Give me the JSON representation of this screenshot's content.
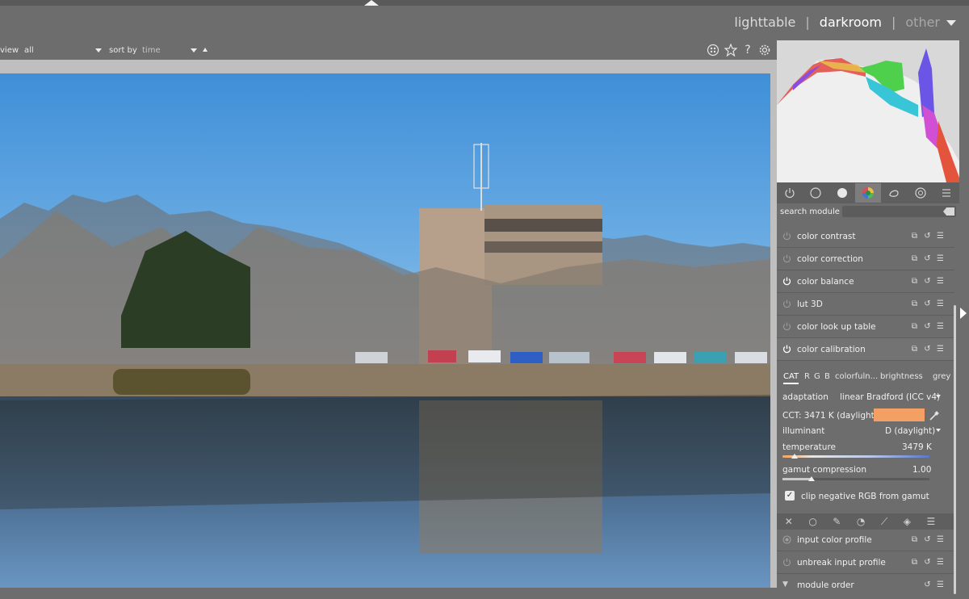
{
  "header": {
    "views": [
      {
        "label": "lighttable",
        "state": "normal"
      },
      {
        "label": "darkroom",
        "state": "active"
      },
      {
        "label": "other",
        "state": "dim"
      }
    ],
    "separator": "|"
  },
  "filterbar": {
    "view_label": "view",
    "view_value": "all",
    "sort_label": "sort by",
    "sort_value": "time"
  },
  "toolbar_icons": [
    "apps-icon",
    "star-icon",
    "help-icon",
    "gear-icon"
  ],
  "search": {
    "label": "search module",
    "placeholder": ""
  },
  "group_tabs": [
    "power-icon",
    "circle-icon",
    "half-circle-icon",
    "color-wheel-icon",
    "correct-icon",
    "effect-icon",
    "menu-icon"
  ],
  "modules_top": [
    {
      "name": "color contrast",
      "enabled": false
    },
    {
      "name": "color correction",
      "enabled": false
    },
    {
      "name": "color balance",
      "enabled": true
    },
    {
      "name": "lut 3D",
      "enabled": false
    },
    {
      "name": "color look up table",
      "enabled": false
    },
    {
      "name": "color calibration",
      "enabled": true,
      "expanded": true
    }
  ],
  "color_calibration": {
    "tabs": [
      "CAT",
      "R",
      "G",
      "B",
      "colorfuln...",
      "brightness",
      "grey"
    ],
    "adaptation_label": "adaptation",
    "adaptation_value": "linear Bradford (ICC v4)",
    "cct_label": "CCT: 3471 K (daylight)",
    "cct_color": "#f4a064",
    "illuminant_label": "illuminant",
    "illuminant_value": "D (daylight)",
    "temperature_label": "temperature",
    "temperature_value": "3479 K",
    "temperature_fraction": 0.08,
    "gamut_label": "gamut compression",
    "gamut_value": "1.00",
    "gamut_fraction": 0.2,
    "clip_label": "clip negative RGB from gamut",
    "clip_checked": true
  },
  "blend_tabs": [
    "close-icon",
    "circle-icon",
    "pen-icon",
    "parametric-icon",
    "drawn-param-icon",
    "raster-icon",
    "menu-icon"
  ],
  "modules_bottom": [
    {
      "name": "input color profile",
      "enabled": false
    },
    {
      "name": "unbreak input profile",
      "enabled": false
    },
    {
      "name": "module order",
      "enabled": false
    }
  ]
}
